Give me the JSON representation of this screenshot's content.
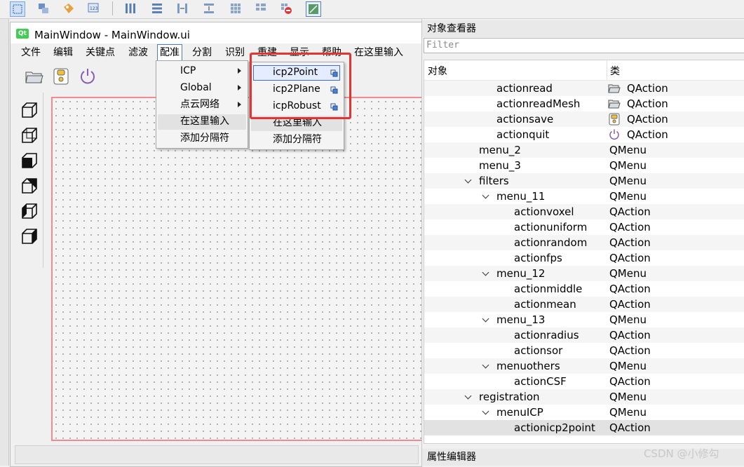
{
  "window": {
    "title": "MainWindow - MainWindow.ui",
    "logo": "Qt"
  },
  "menubar": {
    "items": [
      {
        "label": "文件"
      },
      {
        "label": "编辑"
      },
      {
        "label": "关键点"
      },
      {
        "label": "滤波"
      },
      {
        "label": "配准",
        "active": true
      },
      {
        "label": "分割"
      },
      {
        "label": "识别"
      },
      {
        "label": "重建"
      },
      {
        "label": "显示"
      },
      {
        "label": "帮助"
      },
      {
        "label": "在这里输入"
      }
    ]
  },
  "registration_menu": {
    "items": [
      {
        "label": "ICP",
        "submenu": true
      },
      {
        "label": "Global",
        "submenu": true
      },
      {
        "label": "点云网络",
        "submenu": true
      },
      {
        "label": "在这里输入"
      },
      {
        "label": "添加分隔符"
      }
    ]
  },
  "icp_submenu": {
    "items": [
      {
        "label": "icp2Point",
        "highlighted": true
      },
      {
        "label": "icp2Plane"
      },
      {
        "label": "icpRobust"
      },
      {
        "label": "在这里输入"
      },
      {
        "label": "添加分隔符"
      }
    ]
  },
  "object_inspector": {
    "title": "对象查看器",
    "filter_placeholder": "Filter",
    "col_object": "对象",
    "col_class": "类",
    "rows": [
      {
        "name": "actionread",
        "cls": "QAction",
        "level": 2,
        "icon": "open-folder-icon"
      },
      {
        "name": "actionreadMesh",
        "cls": "QAction",
        "level": 2,
        "icon": "open-folder-icon"
      },
      {
        "name": "actionsave",
        "cls": "QAction",
        "level": 2,
        "icon": "save-icon"
      },
      {
        "name": "actionquit",
        "cls": "QAction",
        "level": 2,
        "icon": "power-icon"
      },
      {
        "name": "menu_2",
        "cls": "QMenu",
        "level": 1
      },
      {
        "name": "menu_3",
        "cls": "QMenu",
        "level": 1
      },
      {
        "name": "filters",
        "cls": "QMenu",
        "level": 1,
        "expanded": true
      },
      {
        "name": "menu_11",
        "cls": "QMenu",
        "level": 2,
        "expanded": true
      },
      {
        "name": "actionvoxel",
        "cls": "QAction",
        "level": 3
      },
      {
        "name": "actionuniform",
        "cls": "QAction",
        "level": 3
      },
      {
        "name": "actionrandom",
        "cls": "QAction",
        "level": 3
      },
      {
        "name": "actionfps",
        "cls": "QAction",
        "level": 3
      },
      {
        "name": "menu_12",
        "cls": "QMenu",
        "level": 2,
        "expanded": true
      },
      {
        "name": "actionmiddle",
        "cls": "QAction",
        "level": 3
      },
      {
        "name": "actionmean",
        "cls": "QAction",
        "level": 3
      },
      {
        "name": "menu_13",
        "cls": "QMenu",
        "level": 2,
        "expanded": true
      },
      {
        "name": "actionradius",
        "cls": "QAction",
        "level": 3
      },
      {
        "name": "actionsor",
        "cls": "QAction",
        "level": 3
      },
      {
        "name": "menuothers",
        "cls": "QMenu",
        "level": 2,
        "expanded": true
      },
      {
        "name": "actionCSF",
        "cls": "QAction",
        "level": 3
      },
      {
        "name": "registration",
        "cls": "QMenu",
        "level": 1,
        "expanded": true
      },
      {
        "name": "menuICP",
        "cls": "QMenu",
        "level": 2,
        "expanded": true
      },
      {
        "name": "actionicp2point",
        "cls": "QAction",
        "level": 3,
        "selected": true
      }
    ]
  },
  "property_editor": {
    "title": "属性编辑器"
  },
  "watermark": "CSDN @小修勾"
}
